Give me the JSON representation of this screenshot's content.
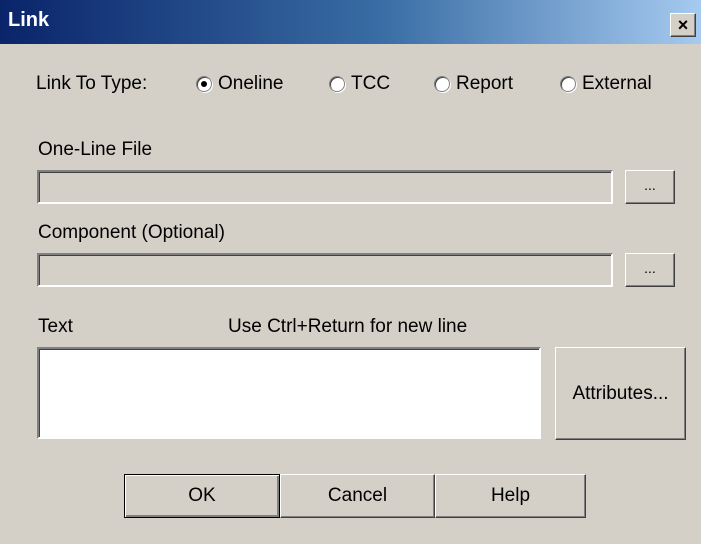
{
  "window": {
    "title": "Link",
    "close_label": "×"
  },
  "link_type": {
    "label": "Link To Type:",
    "options": [
      {
        "label": "Oneline",
        "selected": true
      },
      {
        "label": "TCC",
        "selected": false
      },
      {
        "label": "Report",
        "selected": false
      },
      {
        "label": "External",
        "selected": false
      }
    ]
  },
  "oneline_file": {
    "label": "One-Line File",
    "value": "",
    "browse_label": "..."
  },
  "component": {
    "label": "Component (Optional)",
    "value": "",
    "browse_label": "..."
  },
  "text_section": {
    "label": "Text",
    "hint": "Use Ctrl+Return for new line",
    "value": "",
    "attributes_label": "Attributes..."
  },
  "buttons": {
    "ok": "OK",
    "cancel": "Cancel",
    "help": "Help"
  }
}
